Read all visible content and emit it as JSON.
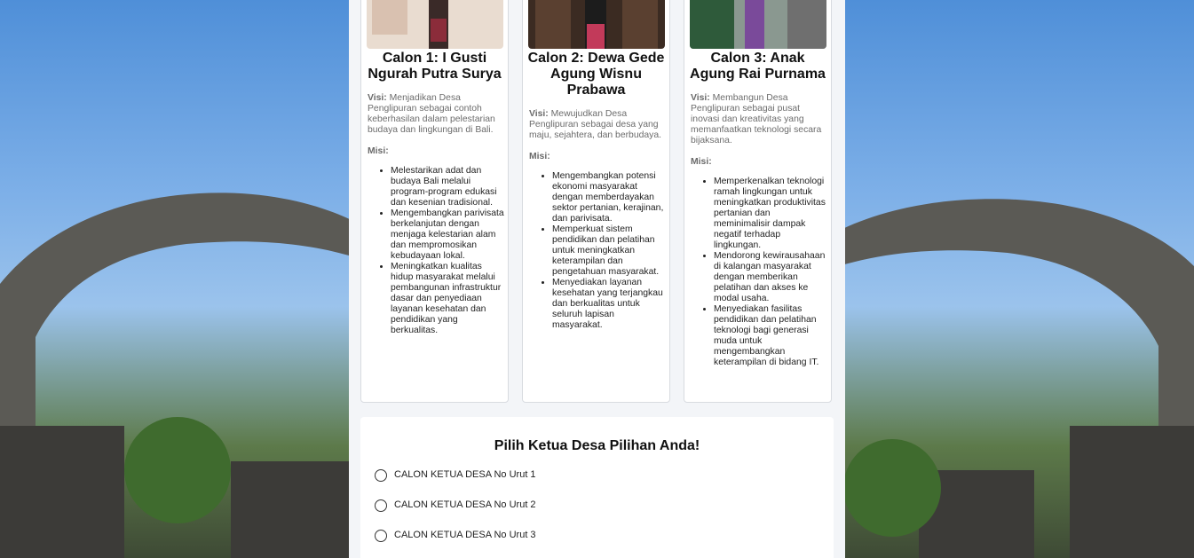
{
  "candidates": [
    {
      "title": "Calon 1: I Gusti Ngurah Putra Surya",
      "visi_label": "Visi:",
      "visi": "Menjadikan Desa Penglipuran sebagai contoh keberhasilan dalam pelestarian budaya dan lingkungan di Bali.",
      "misi_label": "Misi:",
      "misi": [
        "Melestarikan adat dan budaya Bali melalui program-program edukasi dan kesenian tradisional.",
        "Mengembangkan parivisata berkelanjutan dengan menjaga kelestarian alam dan mempromosikan kebudayaan lokal.",
        "Meningkatkan kualitas hidup masyarakat melalui pembangunan infrastruktur dasar dan penyediaan layanan kesehatan dan pendidikan yang berkualitas."
      ]
    },
    {
      "title": "Calon 2: Dewa Gede Agung Wisnu Prabawa",
      "visi_label": "Visi:",
      "visi": "Mewujudkan Desa Penglipuran sebagai desa yang maju, sejahtera, dan berbudaya.",
      "misi_label": "Misi:",
      "misi": [
        "Mengembangkan potensi ekonomi masyarakat dengan memberdayakan sektor pertanian, kerajinan, dan parivisata.",
        "Memperkuat sistem pendidikan dan pelatihan untuk meningkatkan keterampilan dan pengetahuan masyarakat.",
        "Menyediakan layanan kesehatan yang terjangkau dan berkualitas untuk seluruh lapisan masyarakat."
      ]
    },
    {
      "title": "Calon 3: Anak Agung Rai Purnama",
      "visi_label": "Visi:",
      "visi": "Membangun Desa Penglipuran sebagai pusat inovasi dan kreativitas yang memanfaatkan teknologi secara bijaksana.",
      "misi_label": "Misi:",
      "misi": [
        "Memperkenalkan teknologi ramah lingkungan untuk meningkatkan produktivitas pertanian dan meminimalisir dampak negatif terhadap lingkungan.",
        "Mendorong kewirausahaan di kalangan masyarakat dengan memberikan pelatihan dan akses ke modal usaha.",
        "Menyediakan fasilitas pendidikan dan pelatihan teknologi bagi generasi muda untuk mengembangkan keterampilan di bidang IT."
      ]
    }
  ],
  "vote": {
    "title": "Pilih Ketua Desa Pilihan Anda!",
    "options": [
      "CALON KETUA DESA No Urut 1",
      "CALON KETUA DESA No Urut 2",
      "CALON KETUA DESA No Urut 3"
    ]
  },
  "icons": [
    "candidate-photo"
  ]
}
